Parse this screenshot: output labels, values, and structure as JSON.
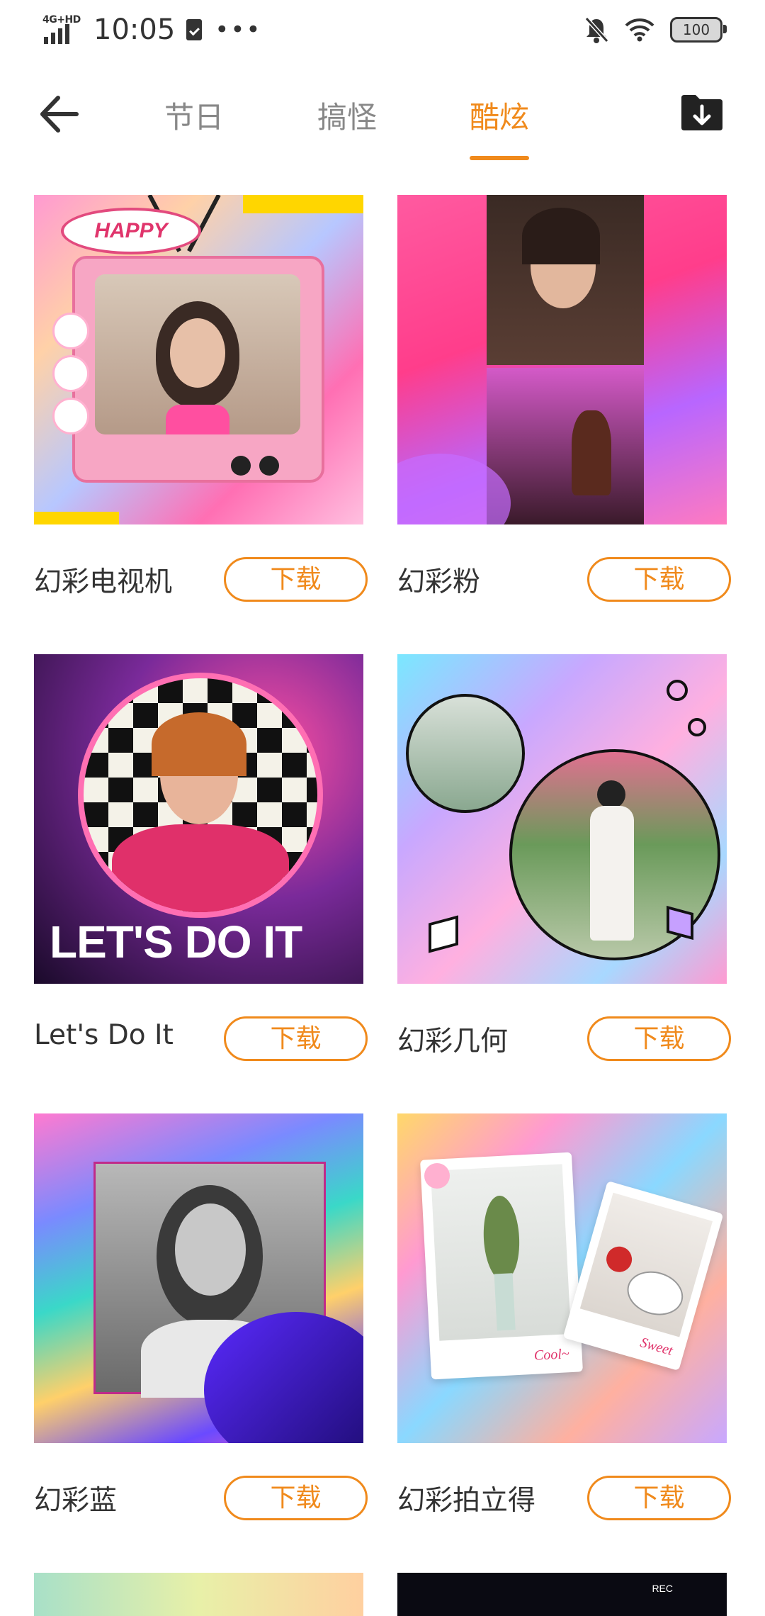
{
  "status_bar": {
    "network": "4G+HD",
    "time": "10:05",
    "overflow": "•••",
    "battery": "100"
  },
  "header": {
    "tabs": [
      {
        "label": "节日",
        "active": false
      },
      {
        "label": "搞怪",
        "active": false
      },
      {
        "label": "酷炫",
        "active": true
      }
    ]
  },
  "colors": {
    "accent": "#F08A1C",
    "tab_inactive": "#888888"
  },
  "cards": [
    {
      "title": "幻彩电视机",
      "button": "下载",
      "image_text": "HAPPY"
    },
    {
      "title": "幻彩粉",
      "button": "下载"
    },
    {
      "title": "Let's Do It",
      "button": "下载",
      "image_text": "LET'S DO IT"
    },
    {
      "title": "幻彩几何",
      "button": "下载"
    },
    {
      "title": "幻彩蓝",
      "button": "下载"
    },
    {
      "title": "幻彩拍立得",
      "button": "下载",
      "image_text_1": "Cool~",
      "image_text_2": "Sweet"
    }
  ],
  "partial_cards": [
    {
      "image_text": "REC"
    }
  ]
}
